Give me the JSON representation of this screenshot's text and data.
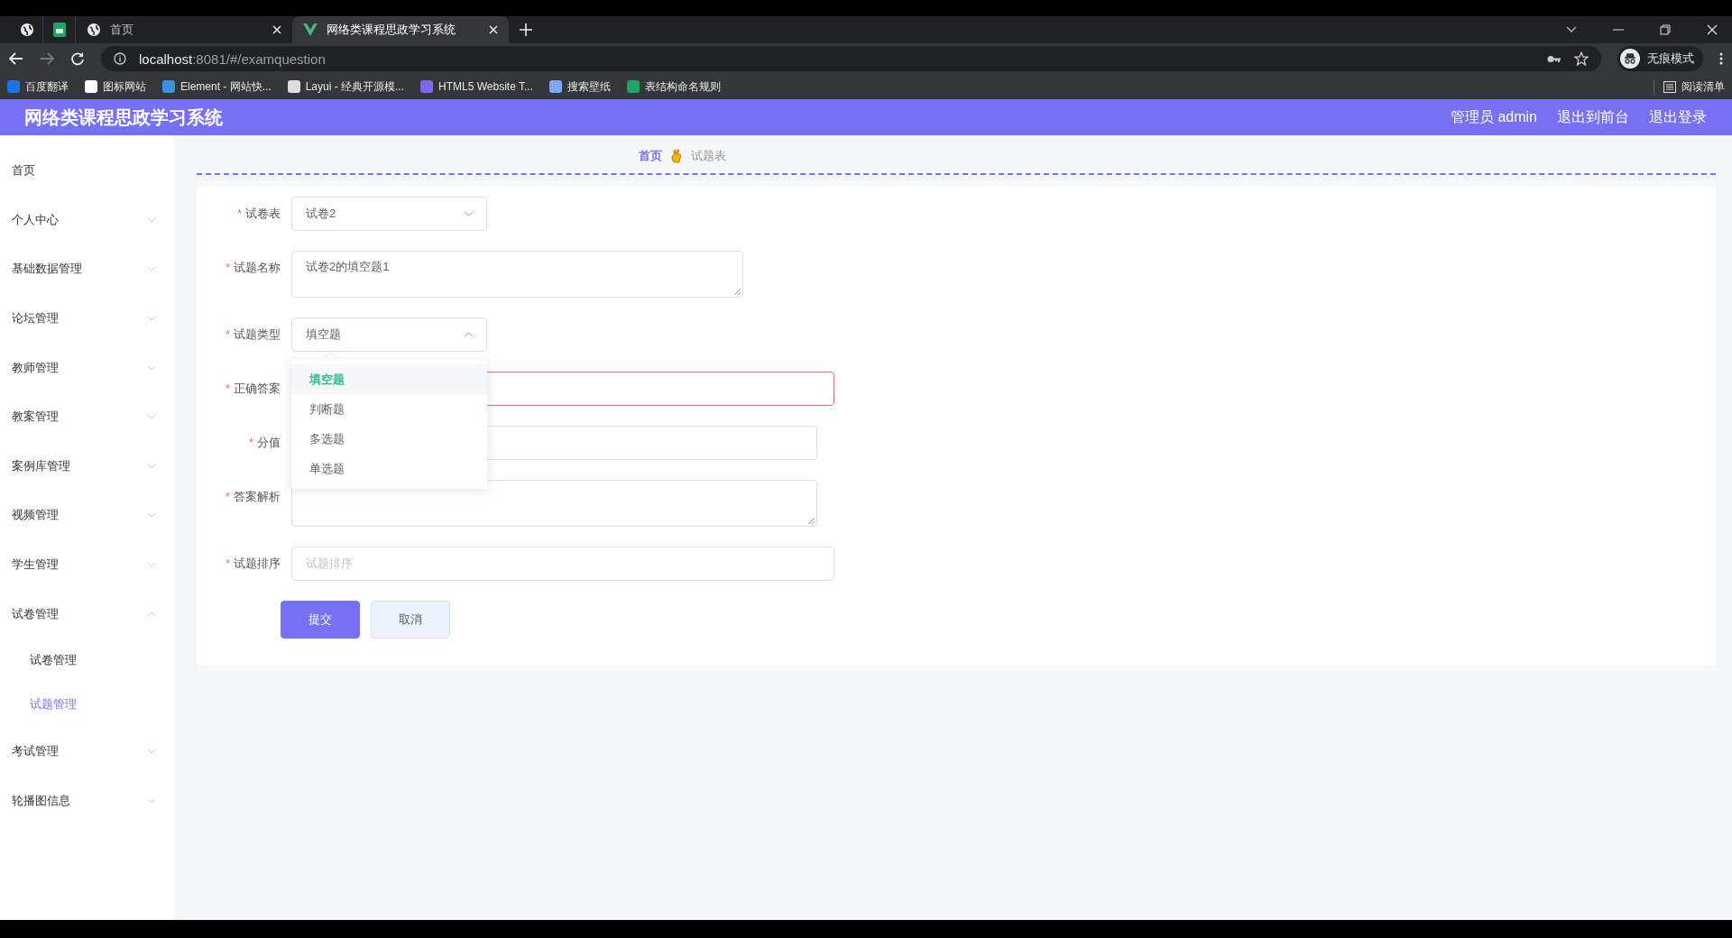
{
  "browser": {
    "tabs": [
      {
        "kind": "pinned-globe",
        "selected": false
      },
      {
        "kind": "pinned-sheet",
        "selected": false
      },
      {
        "kind": "page",
        "title": "首页",
        "selected": false
      },
      {
        "kind": "page",
        "title": "网络类课程思政学习系统",
        "selected": true
      }
    ],
    "address": {
      "host": "localhost",
      "path": ":8081/#/examquestion"
    },
    "profile": "无痕模式",
    "bookmarks": [
      {
        "label": "百度翻译"
      },
      {
        "label": "图标网站"
      },
      {
        "label": "Element - 网站快..."
      },
      {
        "label": "Layui - 经典开源模..."
      },
      {
        "label": "HTML5 Website T..."
      },
      {
        "label": "搜索壁纸"
      },
      {
        "label": "表结构命名规则"
      }
    ],
    "reading_list": "阅读清单"
  },
  "header": {
    "title": "网络类课程思政学习系统",
    "user": "管理员 admin",
    "links": [
      "退出到前台",
      "退出登录"
    ]
  },
  "sidebar": {
    "items": [
      {
        "label": "首页",
        "selected": false
      },
      {
        "label": "个人中心",
        "selected": false,
        "expanded": false
      },
      {
        "label": "基础数据管理",
        "selected": false,
        "expanded": false
      },
      {
        "label": "论坛管理",
        "selected": false,
        "expanded": false
      },
      {
        "label": "教师管理",
        "selected": false,
        "expanded": false
      },
      {
        "label": "教案管理",
        "selected": false,
        "expanded": false
      },
      {
        "label": "案例库管理",
        "selected": false,
        "expanded": false
      },
      {
        "label": "视频管理",
        "selected": false,
        "expanded": false
      },
      {
        "label": "学生管理",
        "selected": false,
        "expanded": false
      },
      {
        "label": "试卷管理",
        "selected": false,
        "expanded": true,
        "children": [
          {
            "label": "试卷管理",
            "selected": false
          },
          {
            "label": "试题管理",
            "selected": true
          }
        ]
      },
      {
        "label": "考试管理",
        "selected": false,
        "expanded": false
      },
      {
        "label": "轮播图信息",
        "selected": false,
        "expanded": false
      }
    ]
  },
  "breadcrumb": [
    "首页",
    "试题表"
  ],
  "form": {
    "fields": [
      {
        "kind": "select",
        "label": "试卷表",
        "required_mark": "*",
        "value": "试卷2",
        "open": false
      },
      {
        "kind": "textarea",
        "label": "试题名称",
        "required_mark": "*",
        "value": "试卷2的填空题1"
      },
      {
        "kind": "select",
        "label": "试题类型",
        "required_mark": "*",
        "value": "填空题",
        "open": true,
        "options": [
          {
            "label": "填空题",
            "selected": true
          },
          {
            "label": "判断题",
            "selected": false
          },
          {
            "label": "多选题",
            "selected": false
          },
          {
            "label": "单选题",
            "selected": false
          }
        ]
      },
      {
        "kind": "input",
        "label": "正确答案",
        "required_mark": "*",
        "error": true,
        "wide": true
      },
      {
        "kind": "input",
        "label": "分值",
        "required_mark": "*",
        "error": false,
        "wide": false
      },
      {
        "kind": "textarea",
        "label": "答案解析",
        "required_mark": "*"
      },
      {
        "kind": "input",
        "label": "试题排序",
        "required_mark": "*",
        "error": false,
        "wide": true,
        "placeholder": "试题排序"
      }
    ],
    "buttons": [
      {
        "kind": "primary",
        "label": "提交"
      },
      {
        "kind": "default",
        "label": "取消"
      }
    ]
  }
}
